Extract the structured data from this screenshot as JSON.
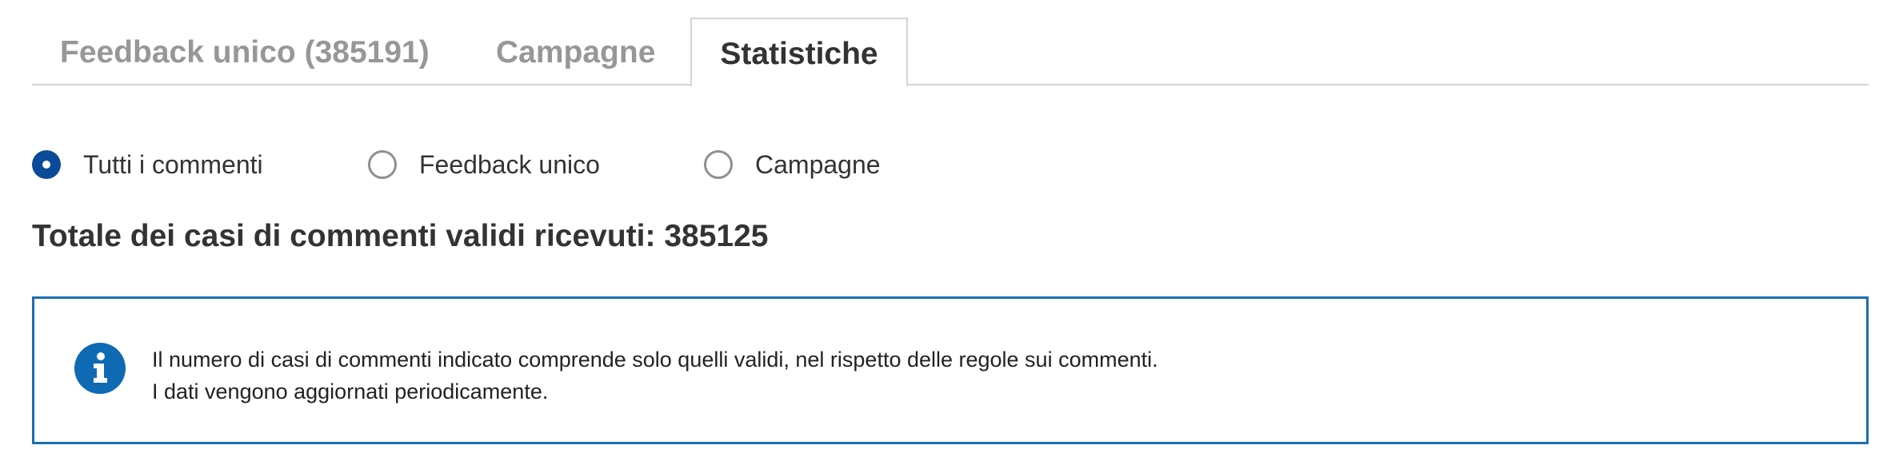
{
  "tabs": [
    {
      "label": "Feedback unico (385191)",
      "active": false
    },
    {
      "label": "Campagne",
      "active": false
    },
    {
      "label": "Statistiche",
      "active": true
    }
  ],
  "filter": {
    "options": [
      {
        "label": "Tutti i commenti",
        "checked": true
      },
      {
        "label": "Feedback unico",
        "checked": false
      },
      {
        "label": "Campagne",
        "checked": false
      }
    ]
  },
  "total": {
    "text": "Totale dei casi di commenti validi ricevuti: 385125"
  },
  "info": {
    "icon": "info-icon",
    "lines": [
      "Il numero di casi di commenti indicato comprende solo quelli validi, nel rispetto delle regole sui commenti.",
      "I dati vengono aggiornati periodicamente."
    ]
  },
  "colors": {
    "accent": "#0b4a99",
    "info_border": "#1a6fb0",
    "info_icon": "#0f6ab4",
    "tab_inactive": "#979797",
    "text": "#333333"
  }
}
